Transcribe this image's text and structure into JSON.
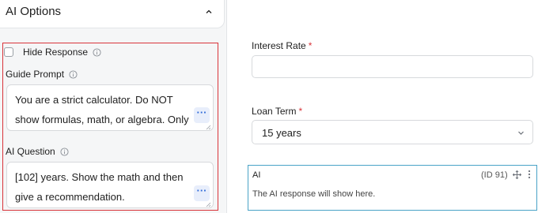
{
  "panel": {
    "title": "AI Options"
  },
  "hide_response": {
    "label": "Hide Response",
    "checked": false
  },
  "guide_prompt": {
    "label": "Guide Prompt",
    "value": "You are a strict calculator. Do NOT show formulas, math, or algebra. Only"
  },
  "ai_question": {
    "label": "AI Question",
    "value": "[102] years. Show the math and then give a recommendation."
  },
  "form": {
    "interest_rate": {
      "label": "Interest Rate",
      "required_mark": "*",
      "value": ""
    },
    "loan_term": {
      "label": "Loan Term",
      "required_mark": "*",
      "selected": "15 years"
    }
  },
  "ai_block": {
    "title": "AI",
    "id_text": "(ID 91)",
    "message": "The AI response will show here."
  },
  "colors": {
    "highlight_border": "#d9343a",
    "ai_block_border": "#4aa3c7",
    "dots_button": "#2f6bd8"
  }
}
